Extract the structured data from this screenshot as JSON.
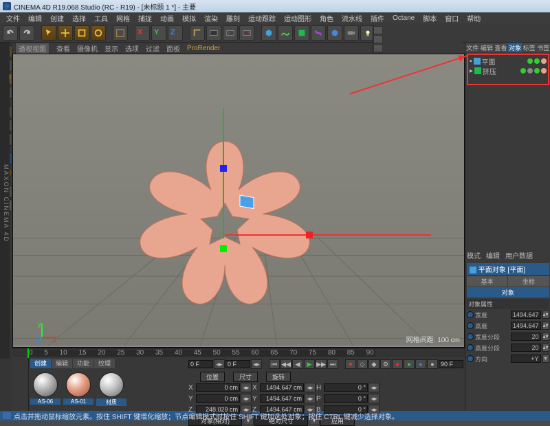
{
  "title": "CINEMA 4D R19.068 Studio (RC - R19) - [未标题 1 *] - 主要",
  "menu": [
    "文件",
    "编辑",
    "创建",
    "选择",
    "工具",
    "网格",
    "捕捉",
    "动画",
    "模拟",
    "渲染",
    "雕刻",
    "运动跟踪",
    "运动图形",
    "角色",
    "流水线",
    "插件",
    "Octane",
    "脚本",
    "窗口",
    "帮助"
  ],
  "vp_menu": [
    "查看",
    "摄像机",
    "显示",
    "选项",
    "过滤",
    "面板",
    "ProRender"
  ],
  "vp_label": "透视视图",
  "hud": "网格间距: 100 cm",
  "timeline": {
    "frames": [
      "0",
      "5",
      "10",
      "15",
      "20",
      "25",
      "30",
      "35",
      "40",
      "45",
      "50",
      "55",
      "60",
      "65",
      "70",
      "75",
      "80",
      "85",
      "90"
    ],
    "start": "0 F",
    "end": "90 F",
    "cur": "0 F"
  },
  "mat_tabs": [
    "创建",
    "编辑",
    "功能",
    "纹理"
  ],
  "materials": [
    {
      "name": "AS-06",
      "c1": "#b8b8b8",
      "c2": "#555"
    },
    {
      "name": "AS-01",
      "c1": "#e8a58c",
      "c2": "#a05038"
    },
    {
      "name": "材质",
      "c1": "#c8c8c8",
      "c2": "#666"
    }
  ],
  "playback": [
    "⏮",
    "◀◀",
    "◀",
    "▶",
    "▶▶",
    "⏭",
    "⏺",
    "🔁"
  ],
  "coords": {
    "label_pos": "位置",
    "label_size": "尺寸",
    "label_rot": "旋转",
    "X": {
      "p": "0 cm",
      "s": "1494.647 cm",
      "r": "0 °",
      "key": "X"
    },
    "Y": {
      "p": "0 cm",
      "s": "1494.647 cm",
      "r": "0 °",
      "key": "Y"
    },
    "Z": {
      "p": "248.029 cm",
      "s": "1494.647 cm",
      "r": "0 °",
      "key": "Z"
    },
    "mode1": "对象(相对)",
    "mode2": "绝对尺寸",
    "apply": "应用",
    "H": "H",
    "P": "P",
    "B": "B"
  },
  "right_tabs_top": [
    "文件",
    "编辑",
    "查看",
    "对象",
    "标签",
    "书签"
  ],
  "objects": [
    {
      "name": "平面",
      "icon": "#48a0d8"
    },
    {
      "name": "挤压",
      "icon": "#1abc4c"
    }
  ],
  "attr_head": [
    "模式",
    "编辑",
    "用户数据"
  ],
  "attr_title": "平面对象 [平面]",
  "attr_tabs": [
    "基本",
    "坐标"
  ],
  "attr_tab2": "对象",
  "attr_section": "对象属性",
  "attrs": [
    {
      "k": "宽度",
      "v": "1494.647"
    },
    {
      "k": "高度",
      "v": "1494.647"
    },
    {
      "k": "宽度分段",
      "v": "20"
    },
    {
      "k": "高度分段",
      "v": "20"
    },
    {
      "k": "方向",
      "v": "+Y"
    }
  ],
  "status": "点击并拖动鼠标缩放元素。按住 SHIFT 键增化缩放；节点编辑模式时按住 SHIFT 键加选处对象；按住 CTRL 键减少选择对象。",
  "logo": "MAXON CINEMA 4D"
}
